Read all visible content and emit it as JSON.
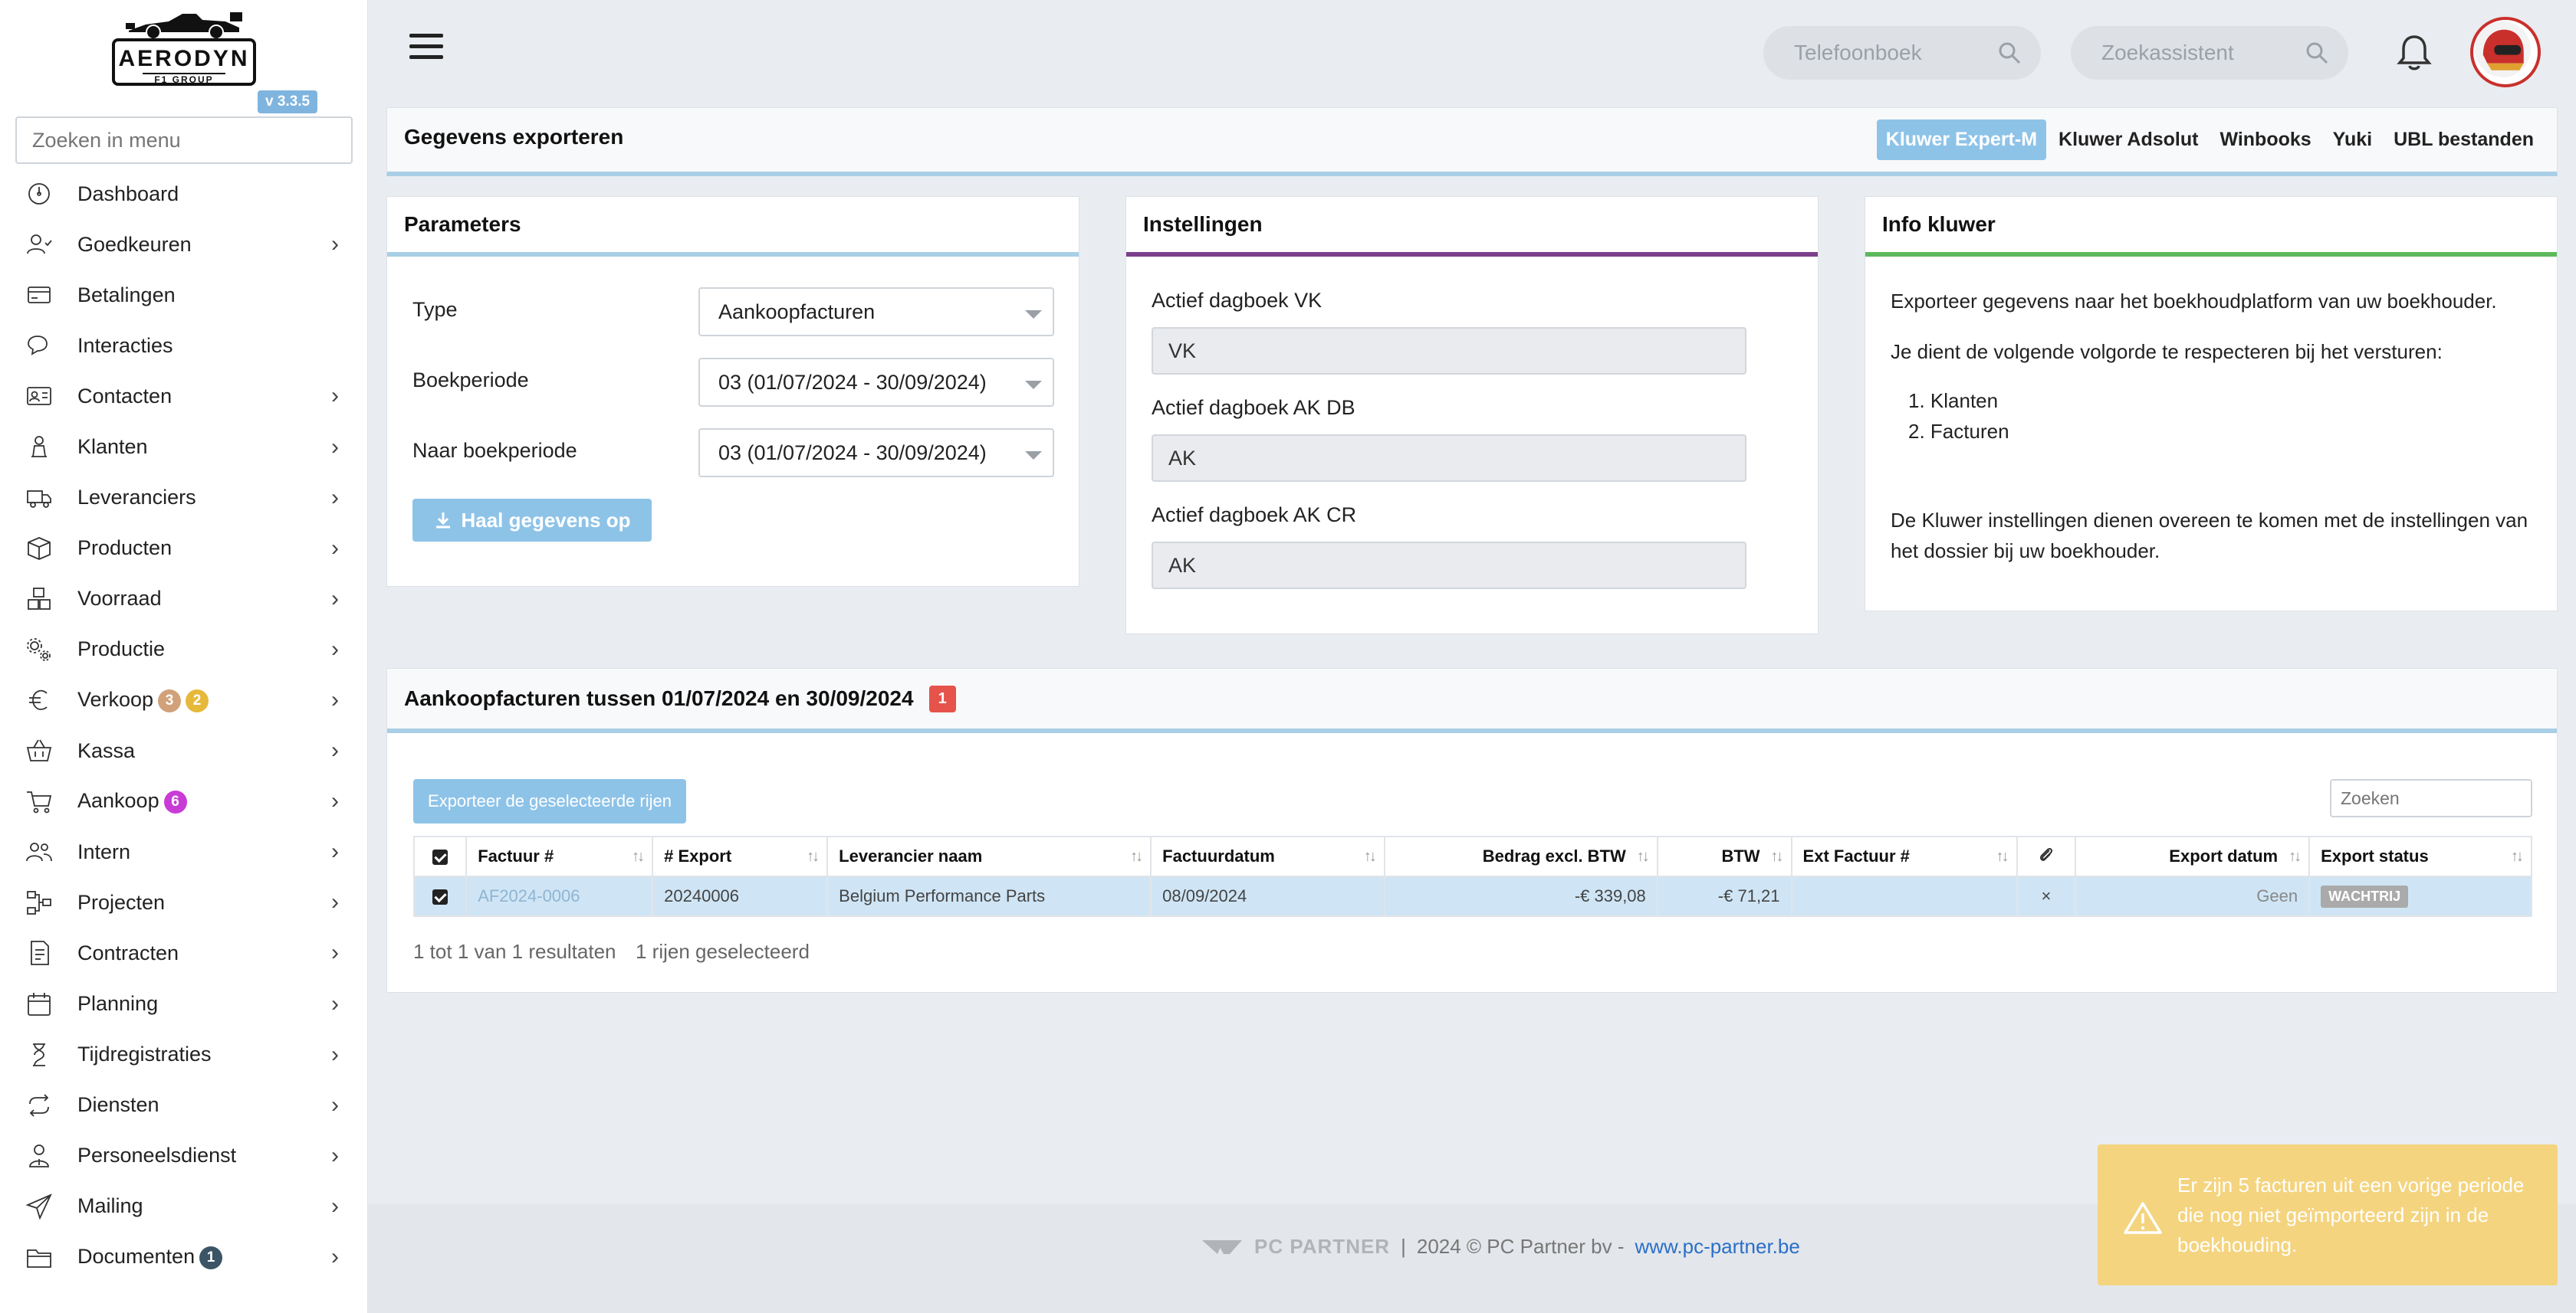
{
  "brand": {
    "name": "AERODYN",
    "sub": "F1 GROUP",
    "version": "v 3.3.5"
  },
  "sidebar": {
    "search_placeholder": "Zoeken in menu",
    "items": [
      {
        "label": "Dashboard",
        "icon": "dashboard-icon",
        "chevron": false
      },
      {
        "label": "Goedkeuren",
        "icon": "user-check-icon",
        "chevron": true
      },
      {
        "label": "Betalingen",
        "icon": "credit-card-icon",
        "chevron": false
      },
      {
        "label": "Interacties",
        "icon": "chat-icon",
        "chevron": false
      },
      {
        "label": "Contacten",
        "icon": "contact-card-icon",
        "chevron": true
      },
      {
        "label": "Klanten",
        "icon": "customer-icon",
        "chevron": true
      },
      {
        "label": "Leveranciers",
        "icon": "truck-icon",
        "chevron": true
      },
      {
        "label": "Producten",
        "icon": "box-icon",
        "chevron": true
      },
      {
        "label": "Voorraad",
        "icon": "boxes-icon",
        "chevron": true
      },
      {
        "label": "Productie",
        "icon": "gears-icon",
        "chevron": true
      },
      {
        "label": "Verkoop",
        "icon": "euro-icon",
        "chevron": true,
        "badges": [
          {
            "v": "3",
            "c": "#d1a17a"
          },
          {
            "v": "2",
            "c": "#e7b93a"
          }
        ]
      },
      {
        "label": "Kassa",
        "icon": "basket-icon",
        "chevron": true
      },
      {
        "label": "Aankoop",
        "icon": "cart-icon",
        "chevron": true,
        "badges": [
          {
            "v": "6",
            "c": "#c93bd6"
          }
        ]
      },
      {
        "label": "Intern",
        "icon": "users-icon",
        "chevron": true
      },
      {
        "label": "Projecten",
        "icon": "project-icon",
        "chevron": true
      },
      {
        "label": "Contracten",
        "icon": "contract-icon",
        "chevron": true
      },
      {
        "label": "Planning",
        "icon": "calendar-icon",
        "chevron": true
      },
      {
        "label": "Tijdregistraties",
        "icon": "clock-icon",
        "chevron": true
      },
      {
        "label": "Diensten",
        "icon": "repeat-icon",
        "chevron": true
      },
      {
        "label": "Personeelsdienst",
        "icon": "staff-icon",
        "chevron": true
      },
      {
        "label": "Mailing",
        "icon": "send-icon",
        "chevron": true
      },
      {
        "label": "Documenten",
        "icon": "folder-icon",
        "chevron": true,
        "badges": [
          {
            "v": "1",
            "c": "#3b5566"
          }
        ]
      }
    ]
  },
  "topbar": {
    "phonebook_placeholder": "Telefoonboek",
    "assistant_placeholder": "Zoekassistent"
  },
  "export": {
    "title": "Gegevens exporteren",
    "tabs": [
      "Kluwer Expert-M",
      "Kluwer Adsolut",
      "Winbooks",
      "Yuki",
      "UBL bestanden"
    ],
    "active_tab": 0
  },
  "parameters": {
    "title": "Parameters",
    "type_label": "Type",
    "type_value": "Aankoopfacturen",
    "period_label": "Boekperiode",
    "period_value": "03 (01/07/2024 - 30/09/2024)",
    "to_period_label": "Naar boekperiode",
    "to_period_value": "03 (01/07/2024 - 30/09/2024)",
    "fetch_button": "Haal gegevens op"
  },
  "settings": {
    "title": "Instellingen",
    "vk_label": "Actief dagboek VK",
    "vk_value": "VK",
    "akdb_label": "Actief dagboek AK DB",
    "akdb_value": "AK",
    "akcr_label": "Actief dagboek AK CR",
    "akcr_value": "AK"
  },
  "info": {
    "title": "Info kluwer",
    "p1": "Exporteer gegevens naar het boekhoudplatform van uw boekhouder.",
    "p2": "Je dient de volgende volgorde te respecteren bij het versturen:",
    "list": [
      "Klanten",
      "Facturen"
    ],
    "p3": "De Kluwer instellingen dienen overeen te komen met de instellingen van het dossier bij uw boekhouder."
  },
  "table": {
    "title": "Aankoopfacturen tussen 01/07/2024 en 30/09/2024",
    "count": "1",
    "export_button": "Exporteer de geselecteerde rijen",
    "search_placeholder": "Zoeken",
    "columns": [
      "Factuur #",
      "# Export",
      "Leverancier naam",
      "Factuurdatum",
      "Bedrag excl. BTW",
      "BTW",
      "Ext Factuur #",
      "",
      "Export datum",
      "Export status"
    ],
    "row": {
      "factuur": "AF2024-0006",
      "export": "20240006",
      "leverancier": "Belgium Performance Parts",
      "datum": "08/09/2024",
      "bedrag": "-€ 339,08",
      "btw": "-€ 71,21",
      "ext": "",
      "attach": "×",
      "export_datum": "Geen",
      "status": "WACHTRIJ"
    },
    "result_info": "1 tot 1 van 1 resultaten",
    "selected_info": "1 rijen geselecteerd"
  },
  "footer": {
    "brand": "PC PARTNER",
    "sep": "|",
    "copy": "2024 © PC Partner bv -",
    "link": "www.pc-partner.be"
  },
  "toast": {
    "message": "Er zijn 5 facturen uit een vorige periode die nog niet geïmporteerd zijn in de boekhouding."
  },
  "colors": {
    "accent": "#8ec3e8",
    "settings_border": "#7b3f8c",
    "info_border": "#5cb85c",
    "warning": "#f4d47f"
  }
}
